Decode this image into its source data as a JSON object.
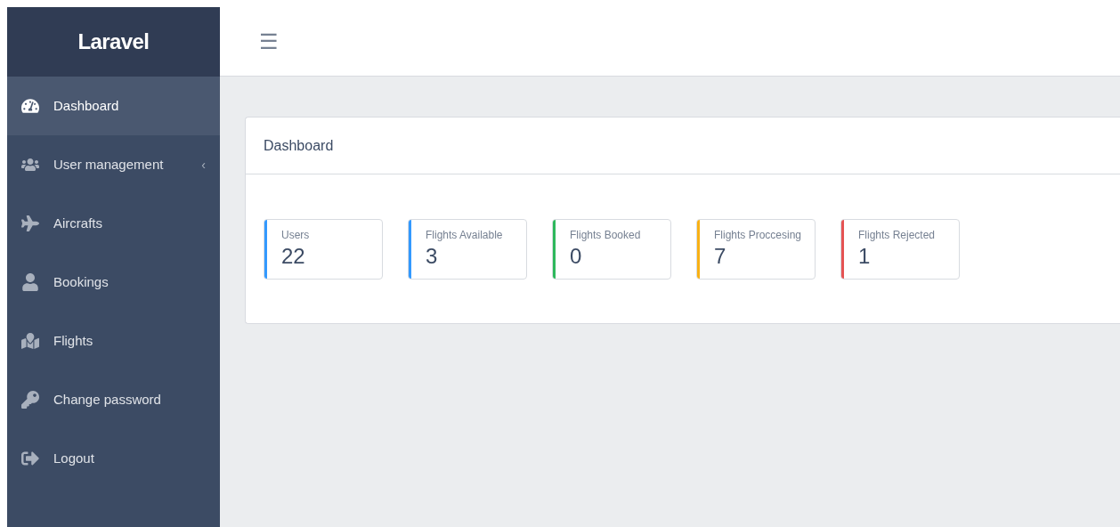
{
  "sidebar": {
    "brand": "Laravel",
    "items": [
      {
        "label": "Dashboard",
        "selected": true
      },
      {
        "label": "User management",
        "selected": false,
        "chevron": "‹"
      },
      {
        "label": "Aircrafts",
        "selected": false
      },
      {
        "label": "Bookings",
        "selected": false
      },
      {
        "label": "Flights",
        "selected": false
      },
      {
        "label": "Change password",
        "selected": false
      },
      {
        "label": "Logout",
        "selected": false
      }
    ]
  },
  "header": {
    "menu_toggle": "☰"
  },
  "card": {
    "title": "Dashboard",
    "stats": [
      {
        "label": "Users",
        "value": "22",
        "color": "#3399ff"
      },
      {
        "label": "Flights Available",
        "value": "3",
        "color": "#3399ff"
      },
      {
        "label": "Flights Booked",
        "value": "0",
        "color": "#2eb85c"
      },
      {
        "label": "Flights Proccesing",
        "value": "7",
        "color": "#f9b115"
      },
      {
        "label": "Flights Rejected",
        "value": "1",
        "color": "#e55353"
      }
    ]
  }
}
